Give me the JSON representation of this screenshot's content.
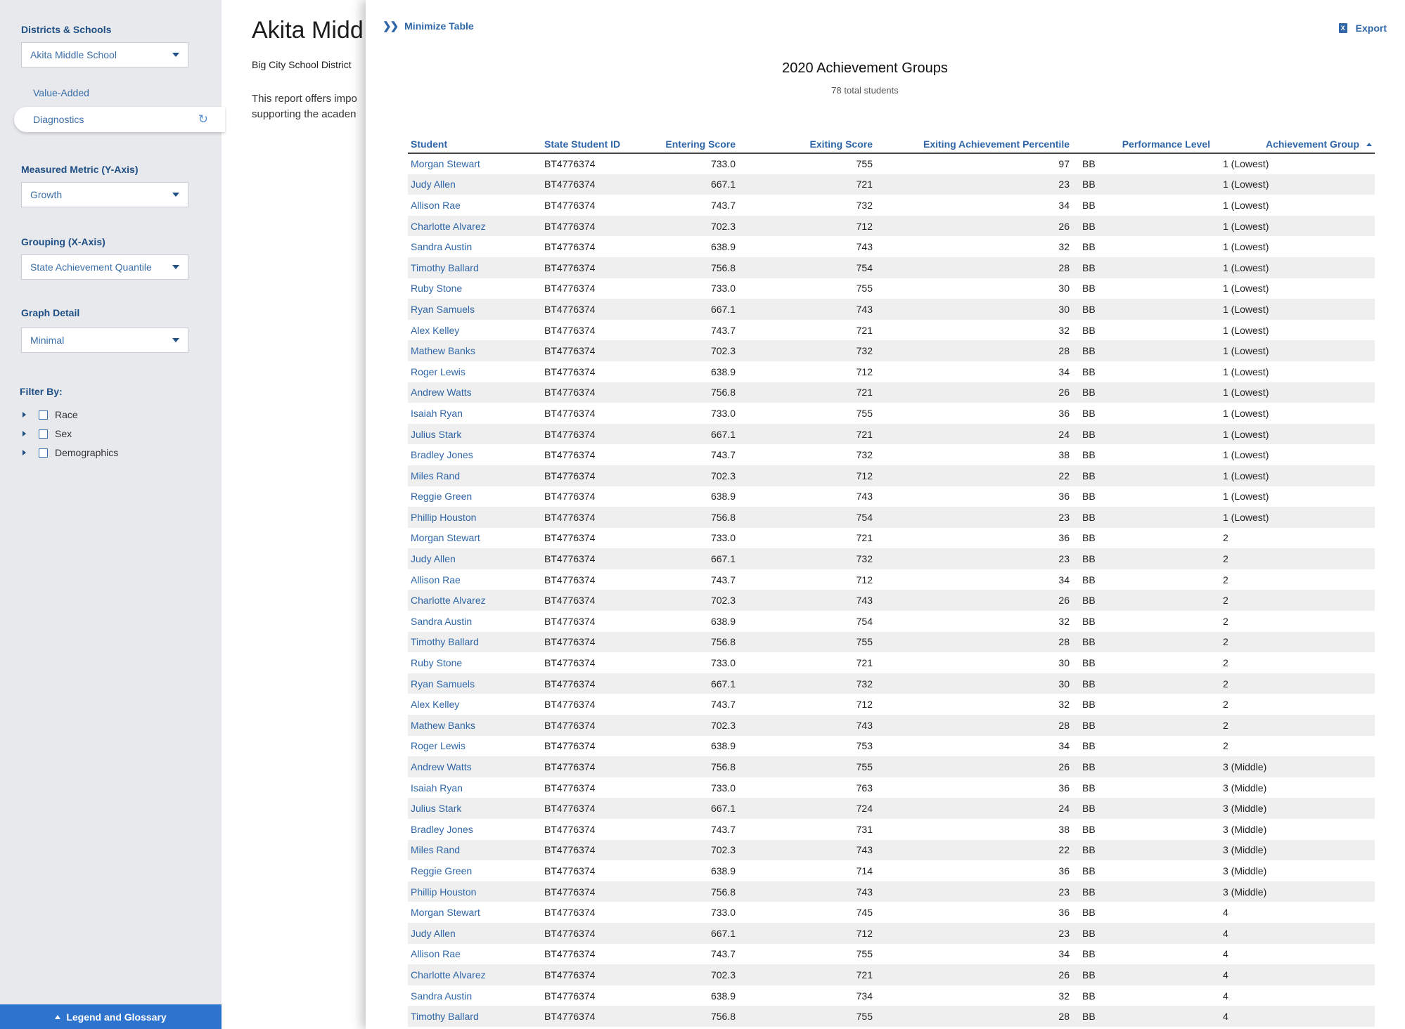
{
  "sidebar": {
    "districts_label": "Districts & Schools",
    "school_select": "Akita Middle School",
    "nav": {
      "value_added": "Value-Added",
      "diagnostics": "Diagnostics"
    },
    "metric_label": "Measured Metric (Y-Axis)",
    "metric_select": "Growth",
    "grouping_label": "Grouping (X-Axis)",
    "grouping_select": "State Achievement Quantile",
    "graph_detail_label": "Graph Detail",
    "graph_detail_select": "Minimal",
    "filter_label": "Filter By:",
    "filters": [
      "Race",
      "Sex",
      "Demographics"
    ],
    "legend_button": "Legend and Glossary"
  },
  "background": {
    "title": "Akita Midd",
    "district": "Big City School District",
    "desc_line1": "This report offers impo",
    "desc_line2": "supporting the acaden"
  },
  "panel": {
    "minimize_label": "Minimize Table",
    "export_label": "Export",
    "title": "2020 Achievement Groups",
    "subtitle": "78 total students",
    "columns": [
      "Student",
      "State Student ID",
      "Entering Score",
      "Exiting Score",
      "Exiting Achievement Percentile",
      "Performance Level",
      "Achievement Group"
    ],
    "rows": [
      [
        "Morgan Stewart",
        "BT4776374",
        "733.0",
        "755",
        "97",
        "BB",
        "1 (Lowest)"
      ],
      [
        "Judy Allen",
        "BT4776374",
        "667.1",
        "721",
        "23",
        "BB",
        "1 (Lowest)"
      ],
      [
        "Allison Rae",
        "BT4776374",
        "743.7",
        "732",
        "34",
        "BB",
        "1 (Lowest)"
      ],
      [
        "Charlotte Alvarez",
        "BT4776374",
        "702.3",
        "712",
        "26",
        "BB",
        "1 (Lowest)"
      ],
      [
        "Sandra Austin",
        "BT4776374",
        "638.9",
        "743",
        "32",
        "BB",
        "1 (Lowest)"
      ],
      [
        "Timothy Ballard",
        "BT4776374",
        "756.8",
        "754",
        "28",
        "BB",
        "1 (Lowest)"
      ],
      [
        "Ruby Stone",
        "BT4776374",
        "733.0",
        "755",
        "30",
        "BB",
        "1 (Lowest)"
      ],
      [
        "Ryan Samuels",
        "BT4776374",
        "667.1",
        "743",
        "30",
        "BB",
        "1 (Lowest)"
      ],
      [
        "Alex Kelley",
        "BT4776374",
        "743.7",
        "721",
        "32",
        "BB",
        "1 (Lowest)"
      ],
      [
        "Mathew Banks",
        "BT4776374",
        "702.3",
        "732",
        "28",
        "BB",
        "1 (Lowest)"
      ],
      [
        "Roger Lewis",
        "BT4776374",
        "638.9",
        "712",
        "34",
        "BB",
        "1 (Lowest)"
      ],
      [
        "Andrew Watts",
        "BT4776374",
        "756.8",
        "721",
        "26",
        "BB",
        "1 (Lowest)"
      ],
      [
        "Isaiah Ryan",
        "BT4776374",
        "733.0",
        "755",
        "36",
        "BB",
        "1 (Lowest)"
      ],
      [
        "Julius Stark",
        "BT4776374",
        "667.1",
        "721",
        "24",
        "BB",
        "1 (Lowest)"
      ],
      [
        "Bradley Jones",
        "BT4776374",
        "743.7",
        "732",
        "38",
        "BB",
        "1 (Lowest)"
      ],
      [
        "Miles Rand",
        "BT4776374",
        "702.3",
        "712",
        "22",
        "BB",
        "1 (Lowest)"
      ],
      [
        "Reggie Green",
        "BT4776374",
        "638.9",
        "743",
        "36",
        "BB",
        "1 (Lowest)"
      ],
      [
        "Phillip Houston",
        "BT4776374",
        "756.8",
        "754",
        "23",
        "BB",
        "1 (Lowest)"
      ],
      [
        "Morgan Stewart",
        "BT4776374",
        "733.0",
        "721",
        "36",
        "BB",
        "2"
      ],
      [
        "Judy Allen",
        "BT4776374",
        "667.1",
        "732",
        "23",
        "BB",
        "2"
      ],
      [
        "Allison Rae",
        "BT4776374",
        "743.7",
        "712",
        "34",
        "BB",
        "2"
      ],
      [
        "Charlotte Alvarez",
        "BT4776374",
        "702.3",
        "743",
        "26",
        "BB",
        "2"
      ],
      [
        "Sandra Austin",
        "BT4776374",
        "638.9",
        "754",
        "32",
        "BB",
        "2"
      ],
      [
        "Timothy Ballard",
        "BT4776374",
        "756.8",
        "755",
        "28",
        "BB",
        "2"
      ],
      [
        "Ruby Stone",
        "BT4776374",
        "733.0",
        "721",
        "30",
        "BB",
        "2"
      ],
      [
        "Ryan Samuels",
        "BT4776374",
        "667.1",
        "732",
        "30",
        "BB",
        "2"
      ],
      [
        "Alex Kelley",
        "BT4776374",
        "743.7",
        "712",
        "32",
        "BB",
        "2"
      ],
      [
        "Mathew Banks",
        "BT4776374",
        "702.3",
        "743",
        "28",
        "BB",
        "2"
      ],
      [
        "Roger Lewis",
        "BT4776374",
        "638.9",
        "753",
        "34",
        "BB",
        "2"
      ],
      [
        "Andrew Watts",
        "BT4776374",
        "756.8",
        "755",
        "26",
        "BB",
        "3 (Middle)"
      ],
      [
        "Isaiah Ryan",
        "BT4776374",
        "733.0",
        "763",
        "36",
        "BB",
        "3 (Middle)"
      ],
      [
        "Julius Stark",
        "BT4776374",
        "667.1",
        "724",
        "24",
        "BB",
        "3 (Middle)"
      ],
      [
        "Bradley Jones",
        "BT4776374",
        "743.7",
        "731",
        "38",
        "BB",
        "3 (Middle)"
      ],
      [
        "Miles Rand",
        "BT4776374",
        "702.3",
        "743",
        "22",
        "BB",
        "3 (Middle)"
      ],
      [
        "Reggie Green",
        "BT4776374",
        "638.9",
        "714",
        "36",
        "BB",
        "3 (Middle)"
      ],
      [
        "Phillip Houston",
        "BT4776374",
        "756.8",
        "743",
        "23",
        "BB",
        "3 (Middle)"
      ],
      [
        "Morgan Stewart",
        "BT4776374",
        "733.0",
        "745",
        "36",
        "BB",
        "4"
      ],
      [
        "Judy Allen",
        "BT4776374",
        "667.1",
        "712",
        "23",
        "BB",
        "4"
      ],
      [
        "Allison Rae",
        "BT4776374",
        "743.7",
        "755",
        "34",
        "BB",
        "4"
      ],
      [
        "Charlotte Alvarez",
        "BT4776374",
        "702.3",
        "721",
        "26",
        "BB",
        "4"
      ],
      [
        "Sandra Austin",
        "BT4776374",
        "638.9",
        "734",
        "32",
        "BB",
        "4"
      ],
      [
        "Timothy Ballard",
        "BT4776374",
        "756.8",
        "755",
        "28",
        "BB",
        "4"
      ]
    ]
  }
}
